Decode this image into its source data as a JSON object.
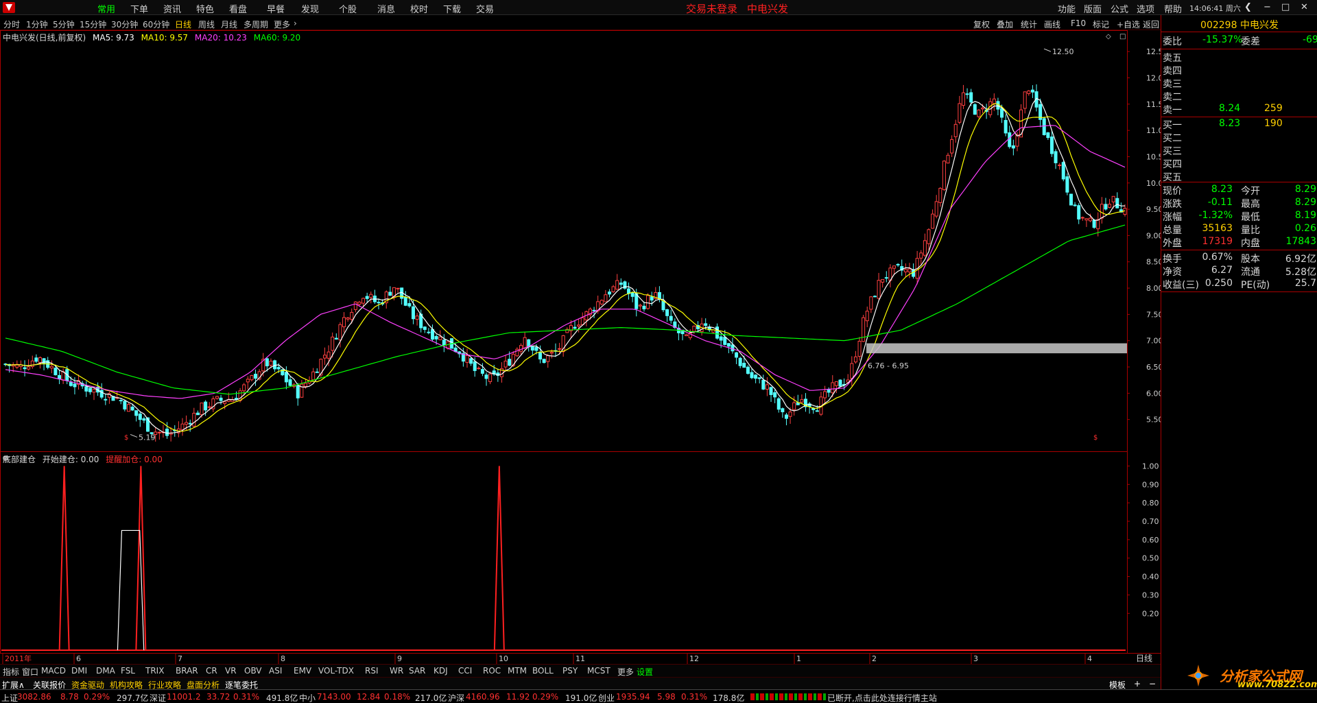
{
  "menubar": {
    "items": [
      "常用",
      "下单",
      "资讯",
      "特色",
      "看盘",
      "早餐",
      "发现",
      "个股",
      "消息",
      "校时",
      "下载",
      "交易"
    ],
    "title_left": "交易未登录",
    "title_right": "中电兴发",
    "right_items": [
      "功能",
      "版面",
      "公式",
      "选项",
      "帮助"
    ],
    "clock": "14:06:41",
    "weekday": "周六"
  },
  "periods": [
    "分时",
    "1分钟",
    "5分钟",
    "15分钟",
    "30分钟",
    "60分钟",
    "日线",
    "周线",
    "月线",
    "多周期",
    "更多"
  ],
  "active_period": "日线",
  "tools": [
    "复权",
    "叠加",
    "统计",
    "画线",
    "F10",
    "标记",
    "+自选",
    "返回"
  ],
  "legend": {
    "name": "中电兴发(日线,前复权)",
    "ma5": "MA5: 9.73",
    "ma10": "MA10: 9.57",
    "ma20": "MA20: 10.23",
    "ma60": "MA60: 9.20",
    "colors": {
      "ma5": "#ffffff",
      "ma10": "#ffff00",
      "ma20": "#ff40ff",
      "ma60": "#00ff00"
    }
  },
  "indicator_legend": {
    "name": "底部建仓",
    "open": "开始建仓: 0.00",
    "add": "提醒加仓: 0.00"
  },
  "chart_annotations": {
    "high_label": "12.50",
    "low_label": "5.19",
    "band_label": "6.76 - 6.95"
  },
  "chart_data": [
    {
      "type": "candlestick",
      "title": "中电兴发(日线,前复权)",
      "ylim": [
        5.0,
        12.75
      ],
      "y_ticks": [
        "12.50",
        "12.00",
        "11.50",
        "11.00",
        "10.50",
        "10.00",
        "9.50",
        "9.00",
        "8.50",
        "8.00",
        "7.50",
        "7.00",
        "6.50",
        "6.00",
        "5.50"
      ],
      "x_ticks": [
        "2011年",
        "6",
        "7",
        "8",
        "9",
        "10",
        "11",
        "12",
        "1",
        "2",
        "3",
        "4"
      ],
      "price_path": [
        6.55,
        6.5,
        6.7,
        6.45,
        6.2,
        6.1,
        6.0,
        5.9,
        5.6,
        5.3,
        5.2,
        5.4,
        5.7,
        5.85,
        5.9,
        6.2,
        6.6,
        6.35,
        6.0,
        6.4,
        6.9,
        7.5,
        7.9,
        7.7,
        8.05,
        7.5,
        7.2,
        7.0,
        6.8,
        6.4,
        6.25,
        6.6,
        7.1,
        6.6,
        6.8,
        7.3,
        7.55,
        7.9,
        8.1,
        7.6,
        7.9,
        7.3,
        7.0,
        7.4,
        7.05,
        6.7,
        6.3,
        6.1,
        5.5,
        5.9,
        5.75,
        6.1,
        6.3,
        7.5,
        8.2,
        8.35,
        8.3,
        9.2,
        10.5,
        11.7,
        11.3,
        11.6,
        10.5,
        11.9,
        11.0,
        10.3,
        9.4,
        9.2,
        9.7,
        9.5
      ],
      "ma20_path": [
        6.45,
        6.35,
        6.2,
        6.05,
        5.95,
        5.9,
        6.0,
        6.4,
        7.0,
        7.5,
        7.7,
        7.35,
        7.05,
        6.75,
        6.65,
        6.9,
        7.3,
        7.6,
        7.6,
        7.3,
        7.0,
        6.8,
        6.35,
        6.05,
        6.1,
        6.9,
        8.0,
        9.5,
        10.4,
        11.05,
        11.1,
        10.6,
        10.3
      ],
      "ma60_path": [
        7.05,
        6.8,
        6.4,
        6.1,
        5.98,
        6.1,
        6.4,
        6.7,
        6.95,
        7.15,
        7.2,
        7.25,
        7.2,
        7.1,
        7.05,
        7.0,
        7.2,
        7.7,
        8.3,
        8.9,
        9.2
      ],
      "overlay_band": {
        "low": 6.76,
        "high": 6.95,
        "label": "6.76 - 6.95"
      },
      "high": 12.5,
      "low": 5.19
    },
    {
      "type": "line",
      "title": "底部建仓",
      "ylim": [
        0,
        1.05
      ],
      "y_ticks": [
        "1.00",
        "0.90",
        "0.80",
        "0.70",
        "0.60",
        "0.50",
        "0.40",
        "0.30",
        "0.20"
      ],
      "series": [
        {
          "name": "提醒加仓",
          "color": "#ff2020",
          "spikes_at_fraction": [
            0.057,
            0.125,
            0.443
          ],
          "peak": 1.0
        },
        {
          "name": "开始建仓",
          "color": "#ffffff",
          "plateau": {
            "from": 0.108,
            "to": 0.124,
            "value": 0.65
          }
        }
      ]
    }
  ],
  "quote": {
    "header": "002298 中电兴发",
    "weibi_label": "委比",
    "weibi_value": "-15.37%",
    "weicha_label": "委差",
    "weicha_value": "-69",
    "sells": [
      {
        "label": "卖五",
        "price": "",
        "vol": ""
      },
      {
        "label": "卖四",
        "price": "",
        "vol": ""
      },
      {
        "label": "卖三",
        "price": "",
        "vol": ""
      },
      {
        "label": "卖二",
        "price": "",
        "vol": ""
      },
      {
        "label": "卖一",
        "price": "8.24",
        "vol": "259"
      }
    ],
    "buys": [
      {
        "label": "买一",
        "price": "8.23",
        "vol": "190"
      },
      {
        "label": "买二",
        "price": "",
        "vol": ""
      },
      {
        "label": "买三",
        "price": "",
        "vol": ""
      },
      {
        "label": "买四",
        "price": "",
        "vol": ""
      },
      {
        "label": "买五",
        "price": "",
        "vol": ""
      }
    ],
    "stats": [
      {
        "l1": "现价",
        "v1": "8.23",
        "l2": "今开",
        "v2": "8.29",
        "c1": "c-green",
        "c2": "c-green"
      },
      {
        "l1": "涨跌",
        "v1": "-0.11",
        "l2": "最高",
        "v2": "8.29",
        "c1": "c-green",
        "c2": "c-green"
      },
      {
        "l1": "涨幅",
        "v1": "-1.32%",
        "l2": "最低",
        "v2": "8.19",
        "c1": "c-green",
        "c2": "c-green"
      },
      {
        "l1": "总量",
        "v1": "35163",
        "l2": "量比",
        "v2": "0.26",
        "c1": "c-yellow",
        "c2": "c-green"
      },
      {
        "l1": "外盘",
        "v1": "17319",
        "l2": "内盘",
        "v2": "17843",
        "c1": "c-red",
        "c2": "c-green"
      }
    ],
    "fundamentals": [
      {
        "l1": "换手",
        "v1": "0.67%",
        "l2": "股本",
        "v2": "6.92亿"
      },
      {
        "l1": "净资",
        "v1": "6.27",
        "l2": "流通",
        "v2": "5.28亿"
      },
      {
        "l1": "收益(三)",
        "v1": "0.250",
        "l2": "PE(动)",
        "v2": "25.7"
      }
    ]
  },
  "indicators": [
    "指标",
    "窗口",
    "MACD",
    "DMI",
    "DMA",
    "FSL",
    "TRIX",
    "BRAR",
    "CR",
    "VR",
    "OBV",
    "ASI",
    "EMV",
    "VOL-TDX",
    "RSI",
    "WR",
    "SAR",
    "KDJ",
    "CCI",
    "ROC",
    "MTM",
    "BOLL",
    "PSY",
    "MCST",
    "更多",
    "设置"
  ],
  "ext_tabs": [
    "扩展∧",
    "关联报价",
    "资金驱动",
    "机构攻略",
    "行业攻略",
    "盘面分析",
    "逐笔委托"
  ],
  "template_label": "模板",
  "dayline_label": "日线",
  "status": {
    "sh_label": "上证",
    "sh_val": "3082.86",
    "sh_chg": "8.78",
    "sh_pct": "0.29%",
    "sh_amt": "297.7亿",
    "sz_label": "深证",
    "sz_val": "11001.2",
    "sz_chg": "33.72",
    "sz_pct": "0.31%",
    "sz_amt": "491.8亿",
    "zx_label": "中小",
    "zx_val": "7143.00",
    "zx_chg": "12.84",
    "zx_pct": "0.18%",
    "zx_amt": "217.0亿",
    "hs_label": "沪深",
    "hs_val": "4160.96",
    "hs_chg": "11.92",
    "hs_pct": "0.29%",
    "hs_amt": "191.0亿",
    "cy_label": "创业",
    "cy_val": "1935.94",
    "cy_chg": "5.98",
    "cy_pct": "0.31%",
    "cy_amt": "178.8亿",
    "message": "已断开,点击此处连接行情主站"
  },
  "brand": {
    "name": "分析家公式网",
    "url": "www.70822.com"
  }
}
